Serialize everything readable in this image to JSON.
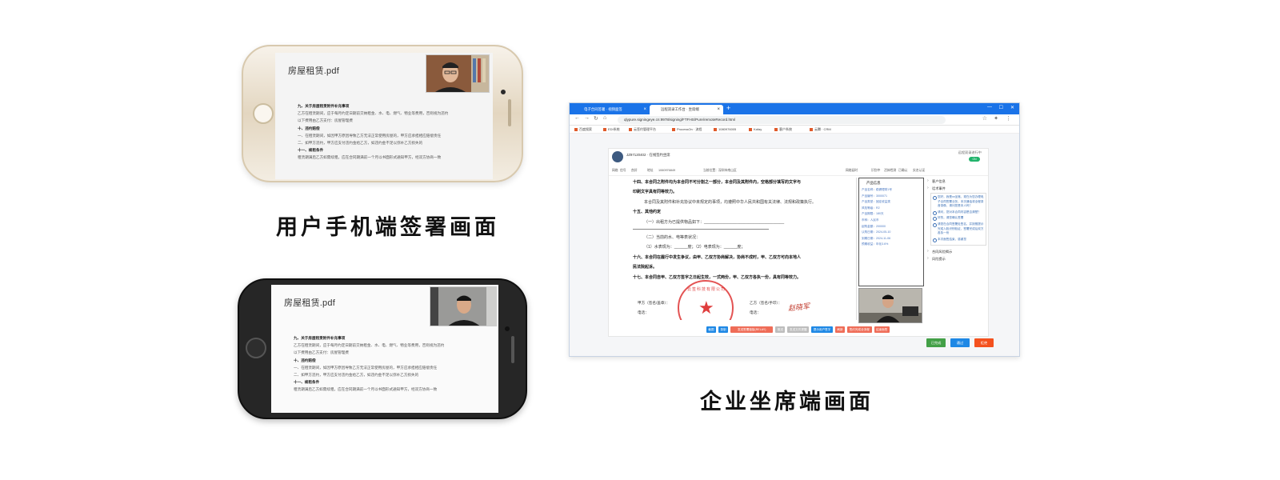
{
  "phone_user_1": {
    "pdf_title": "房屋租赁.pdf",
    "lines": [
      {
        "text": "九、关于房屋租赁附件补充事项",
        "bold": true
      },
      {
        "text": "乙方在租赁期间，应于每月约定日期前交纳租金、水、电、燃气、物业等费用，否则视为违约",
        "bold": false
      },
      {
        "text": "以下费用由乙方支付：房屋管理费",
        "bold": false
      },
      {
        "text": "十、违约赔偿",
        "bold": true
      },
      {
        "text": "一、在租赁期间，如因甲方原因导致乙方无法正常使用房屋的，甲方应承担相应赔偿责任",
        "bold": false
      },
      {
        "text": "二、如甲方违约，甲方应支付违约金给乙方，如违约金不足以弥补乙方损失的",
        "bold": false
      },
      {
        "text": "十一、续租条件",
        "bold": true
      },
      {
        "text": "租赁期满后乙方如需续租，应在合同期满前一个月以书面形式通知甲方，经双方协商一致",
        "bold": false
      }
    ]
  },
  "phone_user_2": {
    "pdf_title": "房屋租赁.pdf",
    "lines": [
      {
        "text": "九、关于房屋租赁附件补充事项",
        "bold": true
      },
      {
        "text": "乙方在租赁期间，应于每月约定日期前交纳租金、水、电、燃气、物业等费用，否则视为违约",
        "bold": false
      },
      {
        "text": "以下费用由乙方支付：房屋管理费",
        "bold": false
      },
      {
        "text": "十、违约赔偿",
        "bold": true
      },
      {
        "text": "一、在租赁期间，如因甲方原因导致乙方无法正常使用房屋的，甲方应承担相应赔偿责任",
        "bold": false
      },
      {
        "text": "二、如甲方违约，甲方应支付违约金给乙方，如违约金不足以弥补乙方损失的",
        "bold": false
      },
      {
        "text": "十一、续租条件",
        "bold": true
      },
      {
        "text": "租赁期满后乙方如需续租，应在合同期满前一个月以书面形式通知甲方，经双方协商一致",
        "bold": false
      }
    ]
  },
  "captions": {
    "phone": "用户手机端签署画面",
    "agent": "企业坐席端画面"
  },
  "browser": {
    "tabs": [
      "电子合同签署 · 视频面签",
      "远程双录工作台 · 坐席端"
    ],
    "url": "qlypure.signingeye.cn:9978/signing/FTFHS/Pure/remoteRecord.html",
    "bookmarks": [
      "百度搜索",
      "EDI系统",
      "云签约管理平台",
      "ProcessOn · 流程",
      "1080976005",
      "Kafay",
      "客户系统",
      "云腾 · CRM"
    ],
    "user_name": "JZ97120402 · 在线签约坐席",
    "session_label": "远程双录进行中",
    "record_toggle": "ON",
    "status_items": [
      "网络",
      "信号",
      "良好",
      "地址",
      "1060976849",
      "当前位置：深圳市南山区",
      "网络延时",
      "识别中",
      "活体检测",
      "已确认",
      "实名认证"
    ],
    "contract_lines": [
      {
        "text": "十四、本合同之附件均为本合同不可分割之一部分，本合同及其附件内，空格部分填写的文字与",
        "style": "bold"
      },
      {
        "text": "印刷文字具有同等效力。",
        "style": "bold"
      },
      {
        "text": "本合同及其附件和补充协议中未规定的事项，均遵照中华人民共和国有关法律、法规和政策执行。",
        "style": "ind"
      },
      {
        "text": "十五、其他约定",
        "style": "bold"
      },
      {
        "text": "（一）出租方为已提供物品如下：____________________________________",
        "style": "ind"
      },
      {
        "text": "",
        "style": "rule"
      },
      {
        "text": "（二）当前的水、电等表状况：",
        "style": "ind"
      },
      {
        "text": "（1）水表现为：______度；（2）电表现为：______度；",
        "style": "ind"
      },
      {
        "text": "十六、本合同在履行中发生争议，由甲、乙双方协商解决，协商不成时，甲、乙双方可向本地人",
        "style": "bold"
      },
      {
        "text": "民法院起诉。",
        "style": "bold"
      },
      {
        "text": "十七、本合同自甲、乙双方签字之日起生效，一式两份，甲、乙双方各执一份，具有同等效力。",
        "style": "bold"
      }
    ],
    "party_a": "甲方（签名/盖章）：",
    "party_b": "乙方（签名/手印）：",
    "phone_a": "电话：",
    "phone_b": "电话：",
    "signature": "赵晓军",
    "seal_text": "云签科技有限公司",
    "product_title": "产品信息",
    "product_rows": [
      "产品名称：稳健理财1号",
      "产品编号：3000071",
      "产品类型：固定收益类",
      "风险等级：R2",
      "产品期限：180天",
      "币种：人民币",
      "起购金额：200000",
      "认购日期：2024-05-10",
      "到期日期：2024-11-06",
      "预期收益：年化3.6%"
    ],
    "side_sections": [
      {
        "title": "客户信息",
        "items": []
      },
      {
        "title": "话术事件",
        "items": [
          "您好，我是xx坐席，现在为您办理电子合同签署业务，本次通话将全程录音录像，请问您是本人吗？",
          "请问，您对本合同内容是否清楚？",
          "好的，请您确认签署",
          "请您在合同签署处签名，并按照提示完成人脸识别验证，签署完成后双方各执一份",
          "本次面签结束，感谢您"
        ]
      },
      {
        "title": "合同风险揭示",
        "items": []
      },
      {
        "title": "风险提示",
        "items": []
      }
    ],
    "action_buttons": [
      {
        "label": "截图",
        "color": "#1e88e5"
      },
      {
        "label": "录制",
        "color": "#1e88e5"
      },
      {
        "label": "发送签署链接(RELAY)",
        "color": "#ef6c57"
      },
      {
        "label": "推送",
        "color": "#bdbdbd"
      },
      {
        "label": "发送文件提醒",
        "color": "#bdbdbd"
      },
      {
        "label": "提示用户签字",
        "color": "#1e88e5"
      },
      {
        "label": "刷新",
        "color": "#ef6c57"
      },
      {
        "label": "签约完成全流程",
        "color": "#ef6c57"
      },
      {
        "label": "结束面签",
        "color": "#ef6c57"
      }
    ],
    "footer_buttons": [
      {
        "label": "已完成",
        "color": "#43a047"
      },
      {
        "label": "通过",
        "color": "#1e88e5"
      },
      {
        "label": "拒绝",
        "color": "#f4511e"
      }
    ]
  }
}
